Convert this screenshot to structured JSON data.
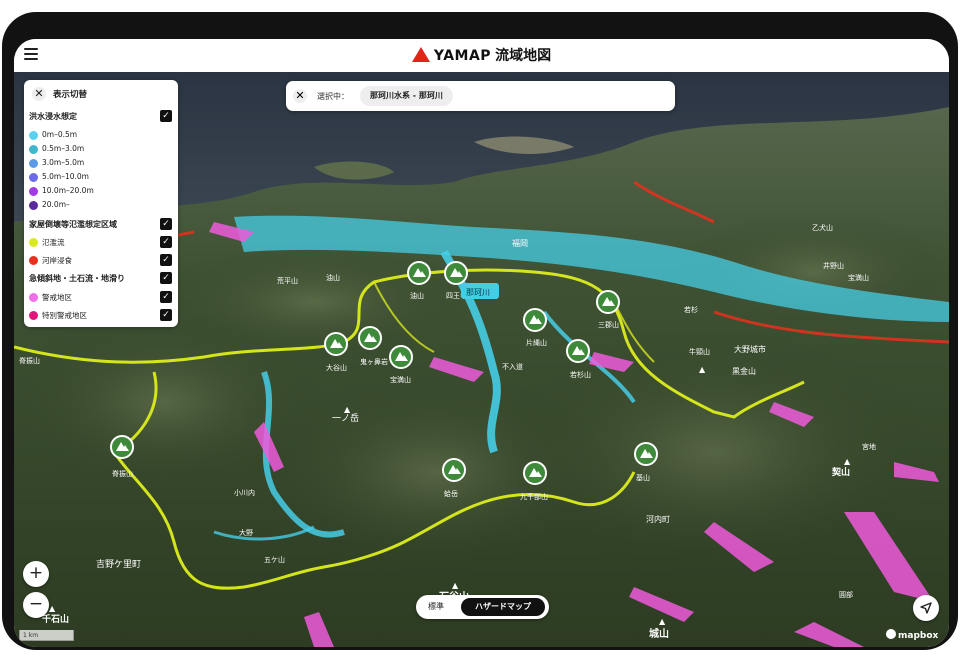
{
  "header": {
    "brand": "YAMAP",
    "product": "流域地図"
  },
  "legend": {
    "title": "表示切替",
    "sections": [
      {
        "title": "洪水浸水想定",
        "checked": true,
        "items": [
          {
            "label": "0m–0.5m",
            "color": "#5ad1f0",
            "checked": false
          },
          {
            "label": "0.5m–3.0m",
            "color": "#3fb6cc",
            "checked": false
          },
          {
            "label": "3.0m–5.0m",
            "color": "#5b9ae8",
            "checked": false
          },
          {
            "label": "5.0m–10.0m",
            "color": "#6b6bea",
            "checked": false
          },
          {
            "label": "10.0m–20.0m",
            "color": "#a23be6",
            "checked": false
          },
          {
            "label": "20.0m–",
            "color": "#5a2a9c",
            "checked": false
          }
        ]
      },
      {
        "title": "家屋倒壊等氾濫想定区域",
        "checked": true,
        "items": [
          {
            "label": "氾濫流",
            "color": "#d7ea1d",
            "checked": true
          },
          {
            "label": "河岸浸食",
            "color": "#e8301c",
            "checked": true
          }
        ]
      },
      {
        "title": "急傾斜地・土石流・地滑り",
        "checked": true,
        "items": [
          {
            "label": "警戒地区",
            "color": "#f06ee8",
            "checked": true
          },
          {
            "label": "特別警戒地区",
            "color": "#e2167a",
            "checked": true
          }
        ]
      }
    ]
  },
  "selection": {
    "label": "選択中：",
    "value": "那珂川水系 - 那珂川"
  },
  "river_tooltip": "那珂川",
  "map_labels": [
    {
      "text": "一ノ岳"
    },
    {
      "text": "石谷山"
    },
    {
      "text": "城山"
    },
    {
      "text": "千石山"
    },
    {
      "text": "吉野ケ里町"
    },
    {
      "text": "大野城市"
    },
    {
      "text": "黒金山"
    },
    {
      "text": "宮地"
    },
    {
      "text": "契山"
    },
    {
      "text": "河内町"
    },
    {
      "text": "五ケ山"
    },
    {
      "text": "牛頸山"
    },
    {
      "text": "福岡"
    },
    {
      "text": "荒平山"
    },
    {
      "text": "油山"
    },
    {
      "text": "井野山"
    },
    {
      "text": "宝満山"
    },
    {
      "text": "小川内"
    },
    {
      "text": "大野"
    },
    {
      "text": "圓部"
    },
    {
      "text": "脊振山"
    },
    {
      "text": "不入道"
    },
    {
      "text": "若杉"
    },
    {
      "text": "乙犬山"
    }
  ],
  "mountains": [
    {
      "label": "脊振山"
    },
    {
      "label": "大谷山"
    },
    {
      "label": "三郡山"
    },
    {
      "label": "若杉山"
    },
    {
      "label": "九千部山"
    },
    {
      "label": "蛤岳"
    },
    {
      "label": "基山"
    },
    {
      "label": "油山"
    },
    {
      "label": "大城山"
    },
    {
      "label": "猪野山"
    },
    {
      "label": "宝満山"
    },
    {
      "label": "四王寺山"
    },
    {
      "label": "片縄山"
    },
    {
      "label": "鬼ヶ鼻岩"
    }
  ],
  "controls": {
    "zoom_in": "+",
    "zoom_out": "−",
    "scale": "1 km",
    "view_standard": "標準",
    "view_hazard": "ハザードマップ",
    "attribution": "mapbox"
  },
  "colors": {
    "flood": "#45cde6",
    "landslide": "#f05adc",
    "boundary": "#d4e51e",
    "accent": "#e2231a",
    "marker": "#3f8a3a"
  }
}
